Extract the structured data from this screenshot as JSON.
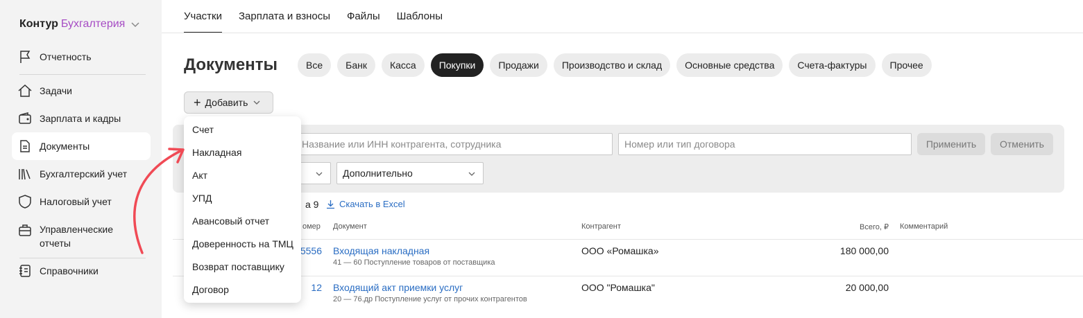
{
  "brand": {
    "name": "Контур",
    "product": "Бухгалтерия"
  },
  "sidebar": {
    "items": [
      {
        "label": "Отчетность",
        "icon": "flag-icon"
      },
      {
        "label": "Задачи",
        "icon": "home-icon"
      },
      {
        "label": "Зарплата и кадры",
        "icon": "wallet-icon"
      },
      {
        "label": "Документы",
        "icon": "document-icon"
      },
      {
        "label": "Бухгалтерский учет",
        "icon": "books-icon"
      },
      {
        "label": "Налоговый учет",
        "icon": "shield-icon"
      },
      {
        "label": "Управленческие отчеты",
        "icon": "briefcase-icon"
      },
      {
        "label": "Справочники",
        "icon": "notebook-icon"
      }
    ]
  },
  "tabs": [
    "Участки",
    "Зарплата и взносы",
    "Файлы",
    "Шаблоны"
  ],
  "page": {
    "title": "Документы"
  },
  "chips": [
    "Все",
    "Банк",
    "Касса",
    "Покупки",
    "Продажи",
    "Производство и склад",
    "Основные средства",
    "Счета-фактуры",
    "Прочее"
  ],
  "active_chip": "Покупки",
  "add_button": {
    "label": "Добавить"
  },
  "filters": {
    "counterparty_placeholder": "Название или ИНН контрагента, сотрудника",
    "contract_placeholder": "Номер или тип договора",
    "apply_label": "Применить",
    "cancel_label": "Отменить",
    "extra_label": "Дополнительно"
  },
  "list": {
    "count_text": "а 9",
    "excel_label": "Скачать в Excel",
    "headers": {
      "number": "омер",
      "document": "Документ",
      "counterparty": "Контрагент",
      "total": "Всего, ₽",
      "comment": "Комментарий"
    },
    "rows": [
      {
        "number": "5556",
        "doc": "Входящая накладная",
        "sub": "41 — 60 Поступление товаров от поставщика",
        "counterparty": "ООО «Ромашка»",
        "total": "180 000,00"
      },
      {
        "number": "12",
        "doc": "Входящий акт приемки услуг",
        "sub": "20 — 76.др Поступление услуг от прочих контрагентов",
        "counterparty": "ООО \"Ромашка\"",
        "total": "20 000,00"
      }
    ]
  },
  "dropdown": {
    "items": [
      "Счет",
      "Накладная",
      "Акт",
      "УПД",
      "Авансовый отчет",
      "Доверенность на ТМЦ",
      "Возврат поставщику",
      "Договор"
    ]
  },
  "colors": {
    "accent": "#a64cc4",
    "link": "#2a6dc3",
    "arrow": "#f04a55",
    "active_chip": "#222222"
  }
}
